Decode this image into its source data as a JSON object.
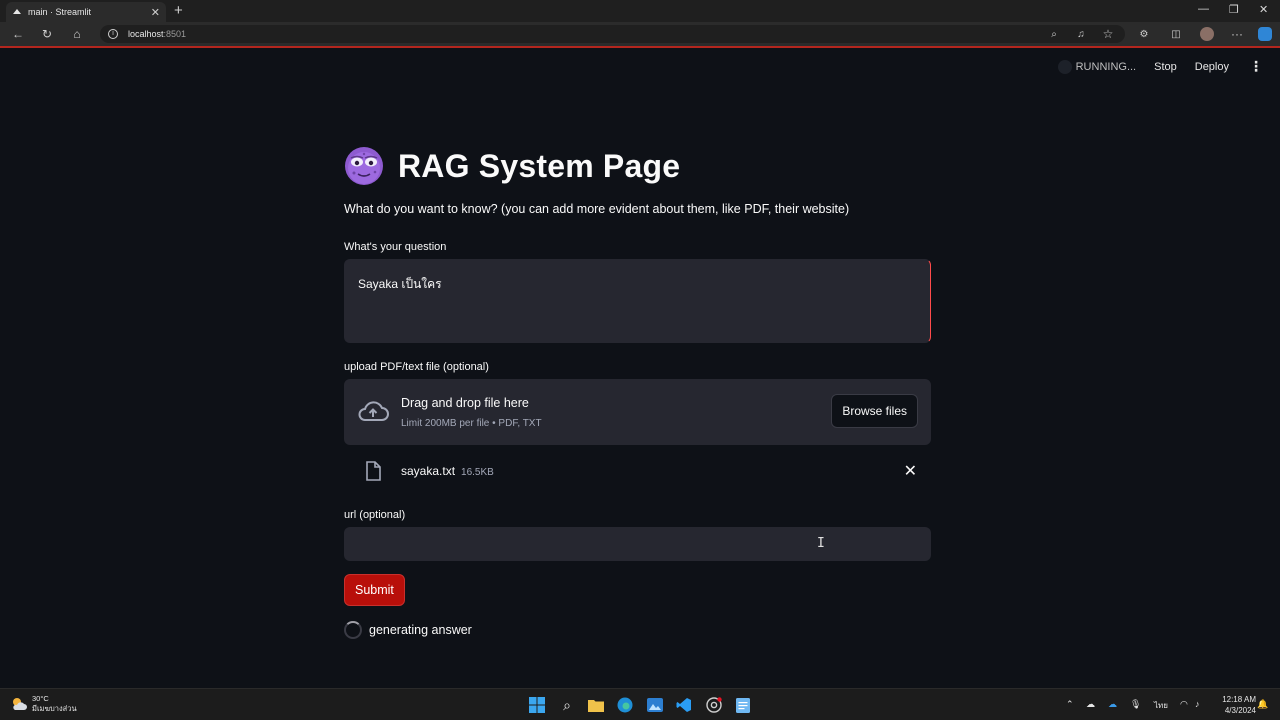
{
  "browser": {
    "tab_title": "main · Streamlit",
    "url_host": "localhost",
    "url_port": ":8501"
  },
  "app_header": {
    "status": "RUNNING...",
    "stop_label": "Stop",
    "deploy_label": "Deploy"
  },
  "main": {
    "title": "RAG System Page",
    "subtitle": "What do you want to know? (you can add more evident about them, like PDF, their website)",
    "question_label": "What's your question",
    "question_value": "Sayaka เป็นใคร",
    "upload_label": "upload PDF/text file (optional)",
    "dropzone_text": "Drag and drop file here",
    "dropzone_limit": "Limit 200MB per file • PDF, TXT",
    "browse_label": "Browse files",
    "file": {
      "name": "sayaka.txt",
      "size": "16.5KB"
    },
    "url_label": "url (optional)",
    "url_value": "",
    "submit_label": "Submit",
    "status_text": "generating answer"
  },
  "taskbar": {
    "temperature": "30°C",
    "weather_desc": "มีเมฆบางส่วน",
    "language": "ไทย",
    "time": "12:18 AM",
    "date": "4/3/2024"
  },
  "colors": {
    "background": "#0e1117",
    "input_bg": "#262730",
    "primary": "#b80f0a",
    "accent_red": "#ff4b4b"
  }
}
